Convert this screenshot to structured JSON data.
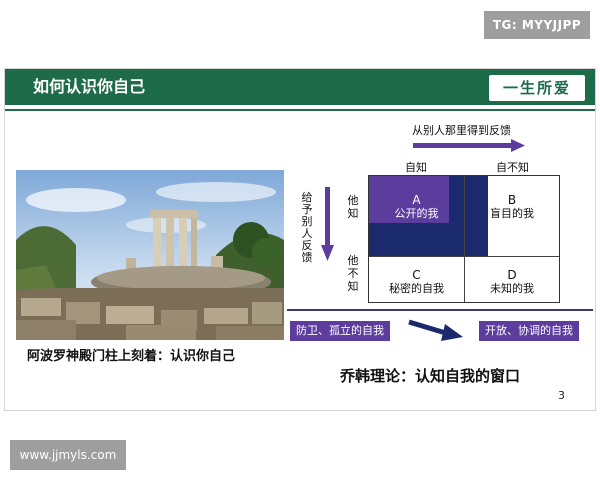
{
  "watermark_top": "TG: MYYJJPP",
  "watermark_bottom": "www.jjmyls.com",
  "slide": {
    "title": "如何认识你自己",
    "brand": "一生所爱",
    "photo_caption": "阿波罗神殿门柱上刻着：认识你自己",
    "johari": {
      "top_arrow_label": "从别人那里得到反馈",
      "left_arrow_label": "给予别人反馈",
      "col_labels": [
        "自知",
        "自不知"
      ],
      "row_labels": [
        "他知",
        "他不知"
      ],
      "cells": [
        {
          "letter": "A",
          "text": "公开的我"
        },
        {
          "letter": "B",
          "text": "盲目的我"
        },
        {
          "letter": "C",
          "text": "秘密的自我"
        },
        {
          "letter": "D",
          "text": "未知的我"
        }
      ],
      "bottom_left": "防卫、孤立的自我",
      "bottom_right": "开放、协调的自我",
      "caption": "乔韩理论：认知自我的窗口"
    },
    "page_number": "3"
  },
  "colors": {
    "header_green": "#1e6b4a",
    "navy": "#1a2a6c",
    "purple": "#5c3d9e",
    "watermark_gray": "#9e9e9e"
  }
}
